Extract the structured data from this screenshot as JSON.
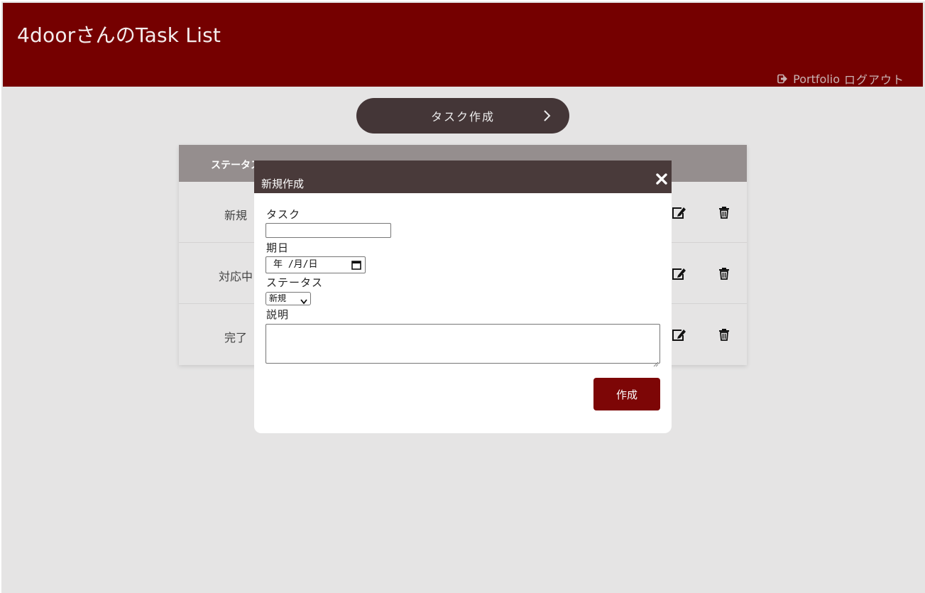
{
  "header": {
    "title": "4doorさんのTask List",
    "links": {
      "portfolio": "Portfolio",
      "logout": "ログアウト"
    }
  },
  "toolbar": {
    "create_label": "タスク作成"
  },
  "table": {
    "columns": [
      "ステータス"
    ],
    "rows": [
      {
        "status": "新規"
      },
      {
        "status": "対応中"
      },
      {
        "status": "完了"
      }
    ]
  },
  "modal": {
    "title": "新規作成",
    "fields": {
      "task_label": "タスク",
      "task_value": "",
      "date_label": "期日",
      "date_placeholder": "年 /月/日",
      "status_label": "ステータス",
      "status_value": "新規",
      "description_label": "説明",
      "description_value": ""
    },
    "submit_label": "作成"
  },
  "colors": {
    "header_bg": "#750000",
    "button_dark": "#443637",
    "modal_header": "#493a3a",
    "submit_bg": "#7d0606",
    "table_head": "#958e8e",
    "page_bg": "#e5e4e4"
  },
  "icons": [
    "logout-icon",
    "chevron-right-icon",
    "edit-icon",
    "trash-icon",
    "close-icon",
    "calendar-icon",
    "dropdown-caret-icon"
  ]
}
